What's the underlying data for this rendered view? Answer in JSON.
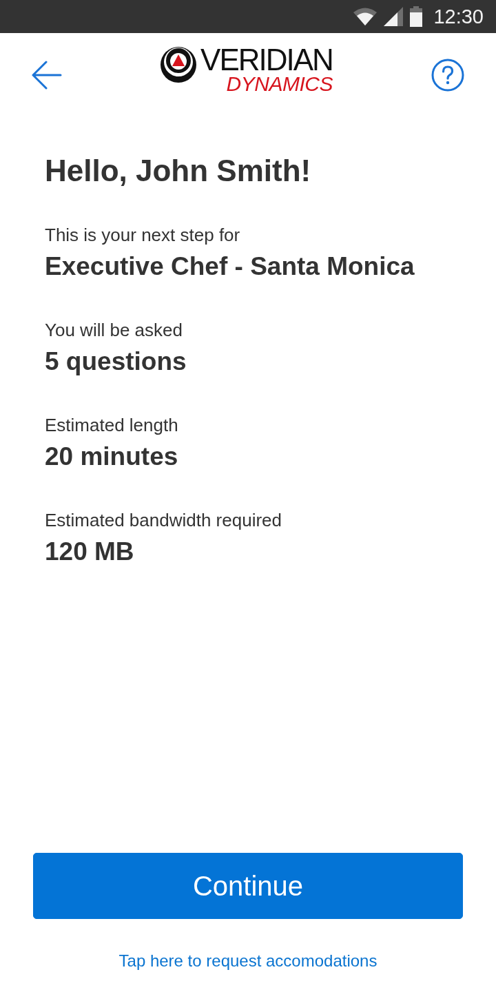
{
  "status_bar": {
    "time": "12:30"
  },
  "header": {
    "logo": {
      "name": "VERIDIAN",
      "tagline": "DYNAMICS"
    }
  },
  "greeting": "Hello, John Smith!",
  "details": [
    {
      "label": "This is your next step for",
      "value": "Executive Chef - Santa Monica"
    },
    {
      "label": "You will be asked",
      "value": "5 questions"
    },
    {
      "label": "Estimated length",
      "value": "20 minutes"
    },
    {
      "label": "Estimated bandwidth required",
      "value": "120 MB"
    }
  ],
  "buttons": {
    "primary": "Continue"
  },
  "link": "Tap here to request accomodations"
}
